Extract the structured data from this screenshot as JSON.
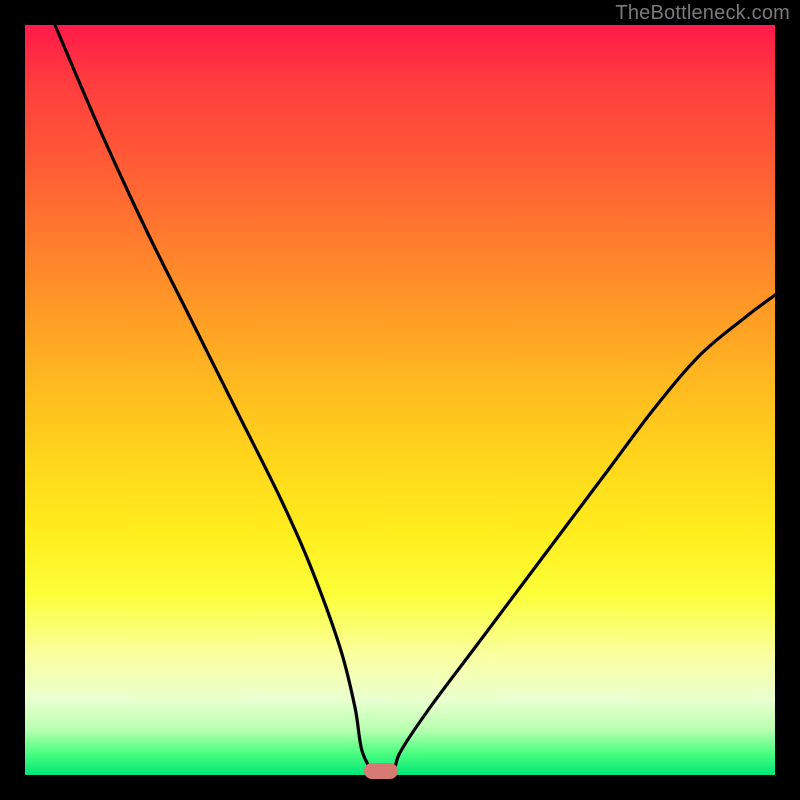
{
  "watermark": "TheBottleneck.com",
  "colors": {
    "frame": "#000000",
    "curve_stroke": "#000000",
    "marker_fill": "#d87a74",
    "watermark_text": "#7a7a7a"
  },
  "chart_data": {
    "type": "line",
    "title": "",
    "xlabel": "",
    "ylabel": "",
    "xlim": [
      0,
      100
    ],
    "ylim": [
      0,
      100
    ],
    "grid": false,
    "notes": "Axes unlabeled; values read from geometry as percent of plot area. V-shaped curve descends from top-left to a minimum near x≈47 then rises to the right edge.",
    "series": [
      {
        "name": "curve",
        "x": [
          4,
          10,
          16,
          22,
          28,
          34,
          38,
          42,
          44,
          45,
          47,
          49,
          50,
          54,
          60,
          66,
          72,
          78,
          84,
          90,
          96,
          100
        ],
        "values": [
          100,
          86,
          73,
          61,
          49,
          37,
          28,
          17,
          9,
          3,
          0,
          0,
          3,
          9,
          17,
          25,
          33,
          41,
          49,
          56,
          61,
          64
        ]
      }
    ],
    "marker": {
      "x": 47.5,
      "y": 0
    },
    "gradient_stops": [
      {
        "pos": 0.0,
        "color": "#ff1a4a"
      },
      {
        "pos": 0.08,
        "color": "#ff3e3e"
      },
      {
        "pos": 0.18,
        "color": "#ff5a36"
      },
      {
        "pos": 0.28,
        "color": "#ff7a2e"
      },
      {
        "pos": 0.38,
        "color": "#ff9a26"
      },
      {
        "pos": 0.48,
        "color": "#ffba20"
      },
      {
        "pos": 0.58,
        "color": "#ffd61c"
      },
      {
        "pos": 0.68,
        "color": "#ffee1e"
      },
      {
        "pos": 0.76,
        "color": "#fbff3a"
      },
      {
        "pos": 0.84,
        "color": "#faffa0"
      },
      {
        "pos": 0.9,
        "color": "#eaffd0"
      },
      {
        "pos": 0.94,
        "color": "#b8ffb0"
      },
      {
        "pos": 0.97,
        "color": "#4eff82"
      },
      {
        "pos": 1.0,
        "color": "#00e676"
      }
    ]
  }
}
